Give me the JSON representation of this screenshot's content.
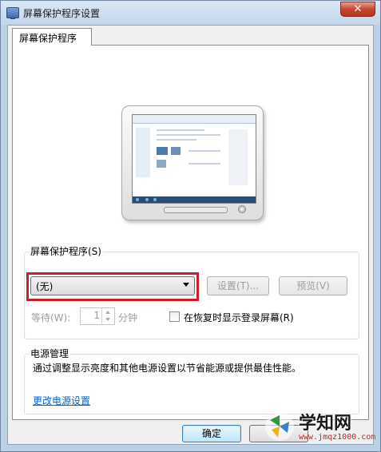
{
  "window": {
    "title": "屏幕保护程序设置",
    "close_glyph": "✕"
  },
  "tab": {
    "label": "屏幕保护程序"
  },
  "screensaver": {
    "group_label": "屏幕保护程序(S)",
    "selected": "(无)",
    "settings_button": "设置(T)...",
    "preview_button": "预览(V)",
    "wait_label": "等待(W):",
    "wait_value": "1",
    "minutes_label": "分钟",
    "resume_checkbox_label": "在恢复时显示登录屏幕(R)",
    "resume_checked": false
  },
  "power": {
    "group_label": "电源管理",
    "description": "通过调整显示亮度和其他电源设置以节省能源或提供最佳性能。",
    "link": "更改电源设置"
  },
  "footer": {
    "ok_button": "确定"
  },
  "watermark": {
    "title": "学知网",
    "url": "www.jmqz1000.com"
  },
  "colors": {
    "highlight": "#c8202a",
    "link": "#0066cc"
  }
}
